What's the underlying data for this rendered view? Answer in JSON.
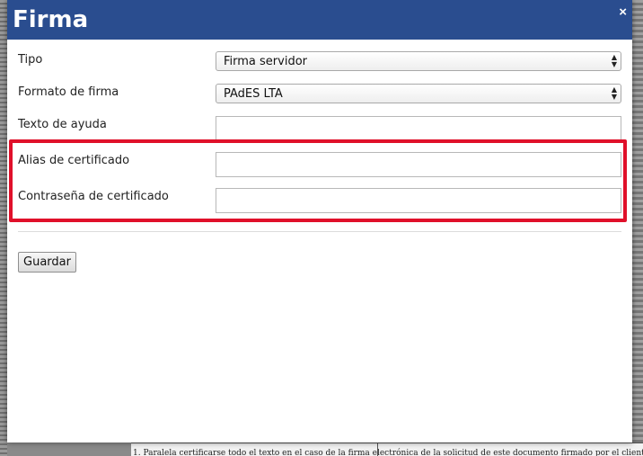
{
  "dialog": {
    "title": "Firma",
    "close_icon": "×"
  },
  "form": {
    "tipo": {
      "label": "Tipo",
      "value": "Firma servidor"
    },
    "formato": {
      "label": "Formato de firma",
      "value": "PAdES LTA"
    },
    "ayuda": {
      "label": "Texto de ayuda",
      "value": ""
    },
    "alias": {
      "label": "Alias de certificado",
      "value": ""
    },
    "password": {
      "label": "Contraseña de certificado",
      "value": ""
    }
  },
  "actions": {
    "save_label": "Guardar"
  },
  "background": {
    "footer_text": "1. Paralela certificarse todo el texto en el caso de la firma electrónica de la solicitud de este documento firmado por el cliente"
  },
  "colors": {
    "header": "#2a4d8f",
    "highlight": "#e0102a"
  }
}
